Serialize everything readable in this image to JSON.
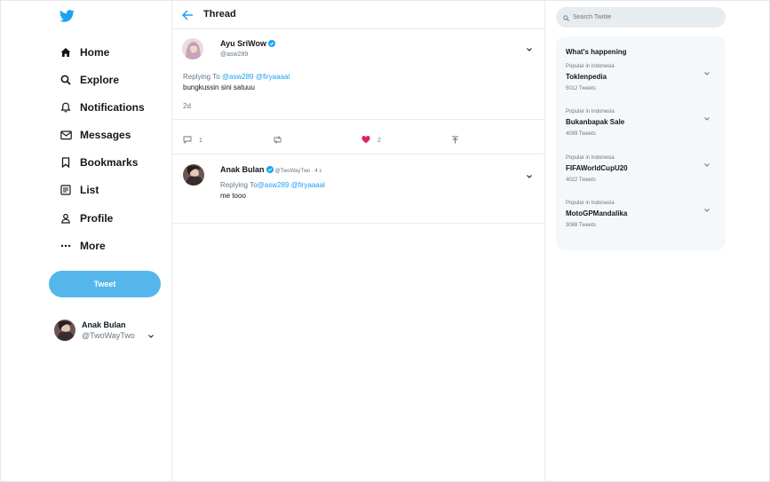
{
  "sidebar": {
    "logo_icon": "twitter-bird-icon",
    "items": [
      {
        "label": "Home",
        "icon": "home-icon"
      },
      {
        "label": "Explore",
        "icon": "search-icon"
      },
      {
        "label": "Notifications",
        "icon": "bell-icon"
      },
      {
        "label": "Messages",
        "icon": "mail-icon"
      },
      {
        "label": "Bookmarks",
        "icon": "bookmark-icon"
      },
      {
        "label": "List",
        "icon": "list-icon"
      },
      {
        "label": "Profile",
        "icon": "person-icon"
      },
      {
        "label": "More",
        "icon": "more-icon"
      }
    ],
    "tweet_button": "Tweet",
    "account": {
      "name": "Anak Bulan",
      "handle": "@TwoWayTwo"
    }
  },
  "main": {
    "title": "Thread",
    "tweet": {
      "name": "Ayu SriWow",
      "handle": "@asw289",
      "replying_prefix": "Replying To",
      "mentions": [
        "@asw289",
        "@firyaaaal"
      ],
      "text": "bungkussin sini satuuu",
      "time": "2d",
      "reply_count": "1",
      "like_count": "2"
    },
    "reply": {
      "name": "Anak Bulan",
      "meta": "@TwoWayTwo . 4 s",
      "replying_prefix": "Replying To",
      "mentions": [
        "@asw289",
        "@firyaaaal"
      ],
      "text": "me tooo"
    }
  },
  "right": {
    "search_placeholder": "Search Twitlie",
    "trends_title": "What's happening",
    "trends": [
      {
        "context": "Popular in Indonesia",
        "name": "Toklenpedia",
        "count": "5012 Tweets"
      },
      {
        "context": "Popular in Indonesia",
        "name": "Bukanbapak Sale",
        "count": "4099 Tweets"
      },
      {
        "context": "Popular in Indonesia",
        "name": "FIFAWorldCupU20",
        "count": "4022 Tweets"
      },
      {
        "context": "Popular in Indonesia",
        "name": "MotoGPMandalika",
        "count": "3088 Tweets"
      }
    ]
  },
  "colors": {
    "accent": "#1da1f2",
    "tweet_button": "#55b6ec",
    "like": "#e0245e"
  }
}
